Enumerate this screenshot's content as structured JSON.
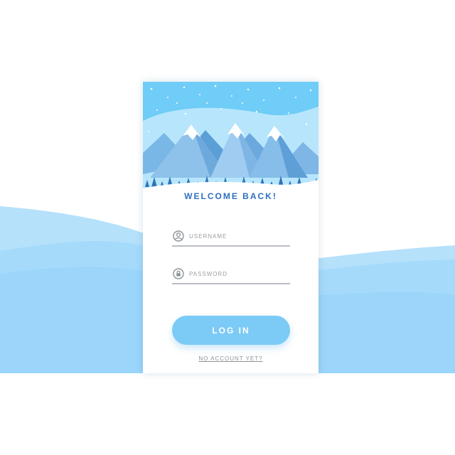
{
  "login_card": {
    "welcome_title": "WELCOME BACK!",
    "username": {
      "placeholder": "USERNAME",
      "value": "",
      "icon": "user-icon"
    },
    "password": {
      "placeholder": "PASSWORD",
      "value": "",
      "icon": "lock-icon"
    },
    "login_label": "LOG IN",
    "signup_link_label": "NO ACCOUNT YET?"
  },
  "colors": {
    "accent": "#7ccaf6",
    "title": "#2f6fbf",
    "sky": "#6fcdf7",
    "background_waves": "#a6dcfb"
  },
  "hero": {
    "illustration": "snowy mountains with pine forest"
  }
}
